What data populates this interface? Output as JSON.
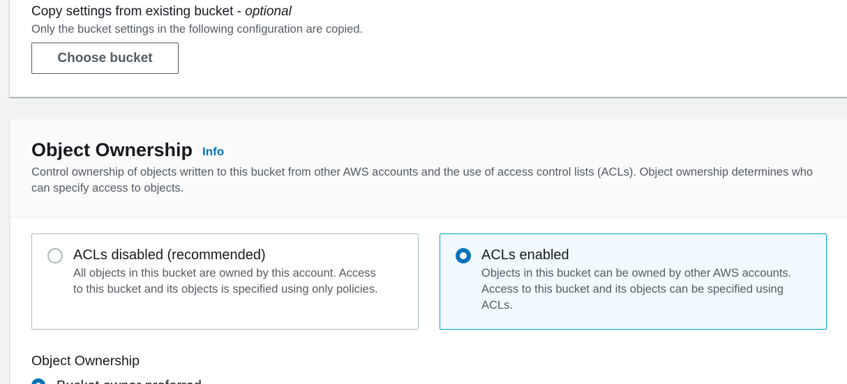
{
  "copy_settings": {
    "title": "Copy settings from existing bucket - ",
    "title_optional": "optional",
    "description": "Only the bucket settings in the following configuration are copied.",
    "choose_button": "Choose bucket"
  },
  "object_ownership": {
    "title": "Object Ownership",
    "info_link": "Info",
    "description": "Control ownership of objects written to this bucket from other AWS accounts and the use of access control lists (ACLs). Object ownership determines who can specify access to objects.",
    "options": [
      {
        "label": "ACLs disabled (recommended)",
        "description": "All objects in this bucket are owned by this account. Access to this bucket and its objects is specified using only policies.",
        "selected": false
      },
      {
        "label": "ACLs enabled",
        "description": "Objects in this bucket can be owned by other AWS accounts. Access to this bucket and its objects can be specified using ACLs.",
        "selected": true
      }
    ],
    "field_label": "Object Ownership",
    "next_option_label": "Bucket owner preferred"
  },
  "colors": {
    "accent": "#0073bb",
    "selected_border": "#00a1c9",
    "selected_bg": "#f1faff",
    "text_secondary": "#545b64"
  }
}
